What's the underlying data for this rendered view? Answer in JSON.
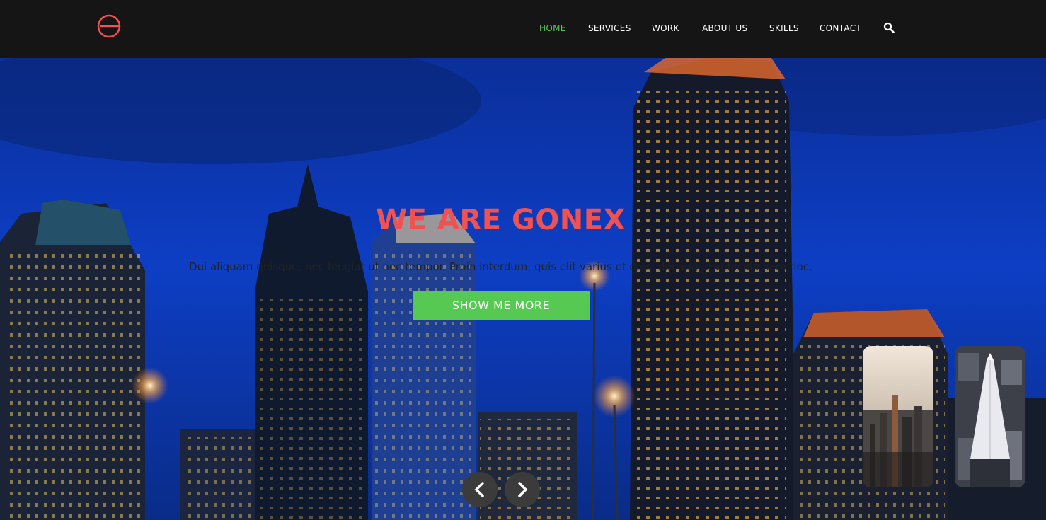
{
  "brand": {
    "logo_icon": "gonex-logo-icon",
    "color": "#f05151"
  },
  "nav": {
    "items": [
      {
        "label": "HOME",
        "active": true
      },
      {
        "label": "SERVICES",
        "active": false
      },
      {
        "label": "WORK",
        "active": false
      },
      {
        "label": "ABOUT US",
        "active": false
      },
      {
        "label": "SKILLS",
        "active": false
      },
      {
        "label": "CONTACT",
        "active": false
      }
    ],
    "search_icon": "search-icon",
    "active_color": "#56c952"
  },
  "hero": {
    "headline": "WE ARE GONEX",
    "subtext": "Dui aliquam quisque, nec feugiat ut nec tempor. Proin interdum, quis elit varius et duis, dui augue vehicula nam tinc.",
    "cta_label": "SHOW ME MORE",
    "cta_color": "#56c952",
    "prev_icon": "chevron-left-icon",
    "next_icon": "chevron-right-icon",
    "thumbnails": [
      "city-skyline-thumbnail",
      "transamerica-tower-thumbnail"
    ]
  }
}
